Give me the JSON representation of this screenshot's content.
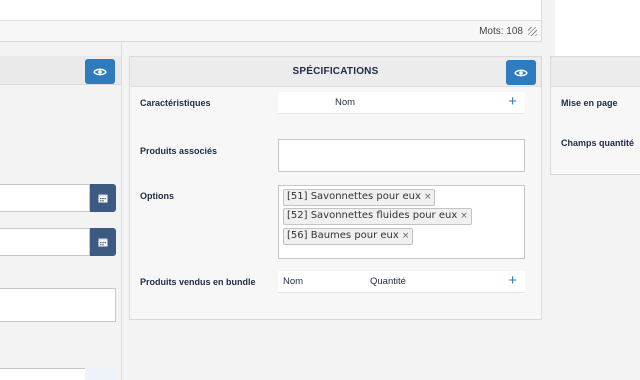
{
  "editor": {
    "word_count": "Mots: 108"
  },
  "specifications": {
    "title": "SPÉCIFICATIONS",
    "characteristics": {
      "label": "Caractéristiques",
      "column_name": "Nom"
    },
    "associated_products": {
      "label": "Produits associés"
    },
    "options": {
      "label": "Options",
      "tags": [
        "[51] Savonnettes pour eux",
        "[52] Savonnettes fluides pour eux",
        "[56] Baumes pour eux"
      ],
      "remove_glyph": "×"
    },
    "bundle": {
      "label": "Produits vendus en bundle",
      "column_name": "Nom",
      "column_quantity": "Quantité"
    },
    "add_glyph": "+"
  },
  "right_panel": {
    "layout_label": "Mise en page",
    "quantity_fields_label": "Champs quantité"
  },
  "colors": {
    "eye_button": "#2f7bbf",
    "calendar_button": "#3d5a80",
    "plus": "#2f7bbf",
    "label_text": "#1f2b44"
  },
  "icons": [
    "eye-icon",
    "calendar-icon",
    "plus-icon",
    "close-icon",
    "resize-handle-icon"
  ]
}
